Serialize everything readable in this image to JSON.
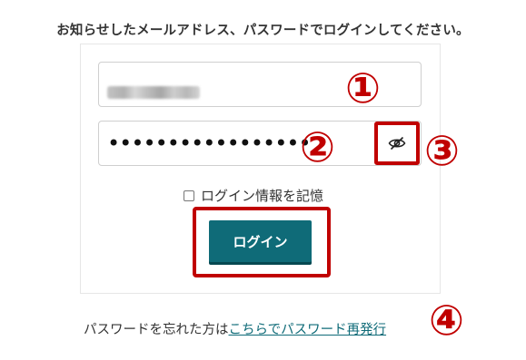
{
  "instruction": "お知らせしたメールアドレス、パスワードでログインしてください。",
  "email": {
    "value_blurred": true
  },
  "password": {
    "masked_value": "•••••••••••••••••"
  },
  "remember": {
    "label": "ログイン情報を記憶",
    "checked": false
  },
  "login_button": {
    "label": "ログイン"
  },
  "forgot": {
    "prefix": "パスワードを忘れた方は",
    "link": "こちらでパスワード再発行"
  },
  "annotations": {
    "one": "①",
    "two": "②",
    "three": "③",
    "four": "④"
  },
  "colors": {
    "accent": "#0f6b78",
    "annotation_red": "#c00000"
  },
  "icons": {
    "toggle_visibility": "eye-off-icon"
  }
}
